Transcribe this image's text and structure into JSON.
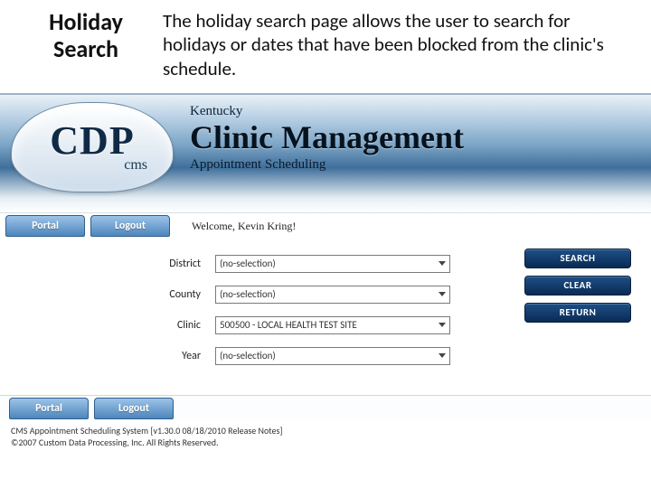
{
  "slide": {
    "title_line1": "Holiday",
    "title_line2": "Search",
    "description": "The holiday search page allows the user to search for holidays or dates that have been blocked from the clinic's schedule."
  },
  "branding": {
    "logo_main": "CDP",
    "logo_sub": "cms",
    "state": "Kentucky",
    "app_title": "Clinic Management",
    "app_subtitle": "Appointment Scheduling"
  },
  "nav": {
    "portal": "Portal",
    "logout": "Logout"
  },
  "welcome": "Welcome, Kevin Kring!",
  "form": {
    "labels": {
      "district": "District",
      "county": "County",
      "clinic": "Clinic",
      "year": "Year"
    },
    "values": {
      "district": "(no-selection)",
      "county": "(no-selection)",
      "clinic": "500500 - LOCAL HEALTH TEST SITE",
      "year": "(no-selection)"
    }
  },
  "actions": {
    "search": "SEARCH",
    "clear": "CLEAR",
    "return": "RETURN"
  },
  "footer": {
    "line1": "CMS Appointment Scheduling System [v1.30.0 08/18/2010 Release Notes]",
    "line2": "©2007 Custom Data Processing, Inc. All Rights Reserved."
  }
}
